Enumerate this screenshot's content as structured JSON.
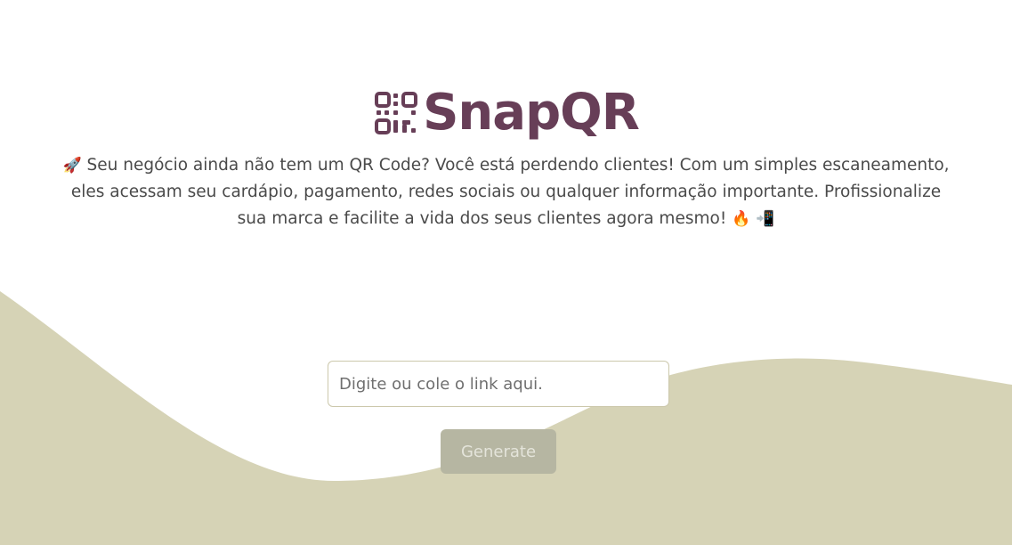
{
  "brand": {
    "title": "SnapQR",
    "logo_icon": "qr-code-icon",
    "color": "#673e57"
  },
  "description": {
    "lead_emoji": "🚀",
    "text": "Seu negócio ainda não tem um QR Code? Você está perdendo clientes! Com um simples escaneamento, eles acessam seu cardápio, pagamento, redes sociais ou qualquer informação importante. Profissionalize sua marca e facilite a vida dos seus clientes agora mesmo!",
    "trail_emoji_1": "🔥",
    "trail_emoji_2": "📲"
  },
  "form": {
    "url_placeholder": "Digite ou cole o link aqui.",
    "url_value": "",
    "generate_label": "Generate"
  },
  "colors": {
    "wave": "#d6d3b6",
    "button_bg": "#b6b6a2",
    "button_text": "#e4e4da"
  }
}
